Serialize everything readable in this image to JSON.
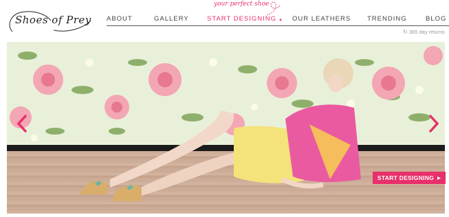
{
  "brand": {
    "logo_text": "Shoes of Prey"
  },
  "tagline": "your perfect shoe",
  "nav": {
    "items": [
      {
        "label": "ABOUT"
      },
      {
        "label": "GALLERY"
      },
      {
        "label": "START DESIGNING"
      },
      {
        "label": "OUR LEATHERS"
      },
      {
        "label": "TRENDING"
      },
      {
        "label": "BLOG"
      }
    ],
    "active_index": 2
  },
  "returns_text": "365 day returns",
  "hero": {
    "cta_label": "START DESIGNING",
    "accent_color": "#e8306a"
  },
  "icons": [
    "chevron-left-icon",
    "chevron-right-icon",
    "play-triangle-icon",
    "refresh-icon"
  ]
}
